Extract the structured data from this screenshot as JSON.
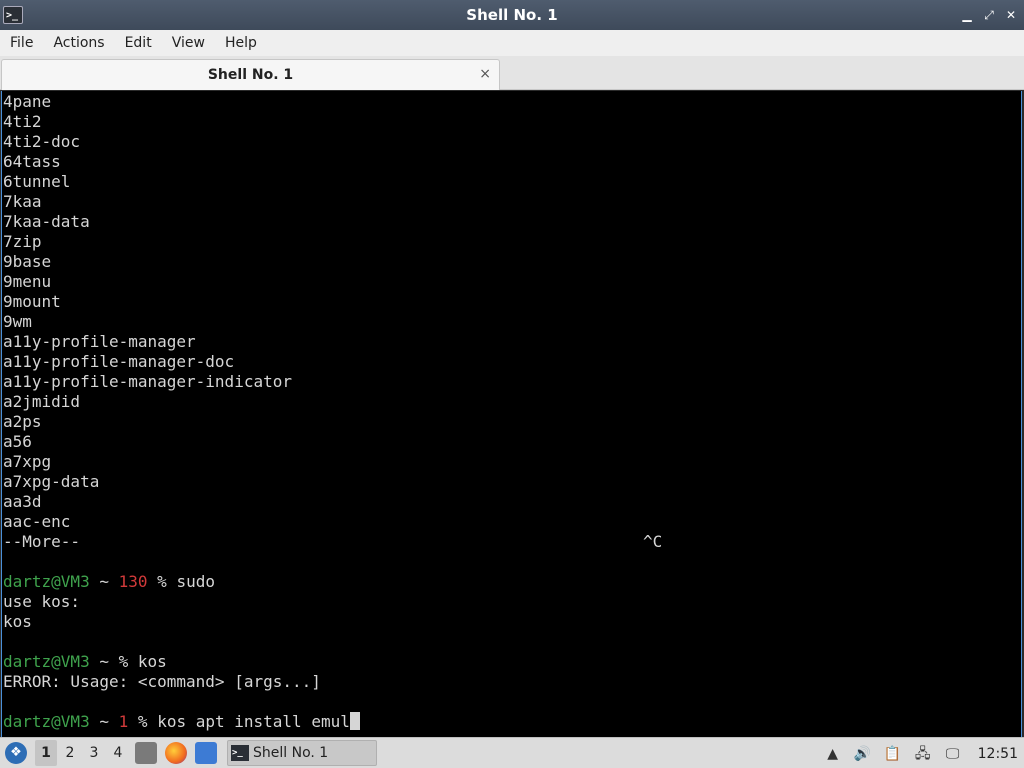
{
  "window": {
    "title": "Shell No. 1",
    "icon": "terminal-icon",
    "controls": [
      "minimize-icon",
      "maximize-icon",
      "close-icon"
    ]
  },
  "menu": {
    "items": [
      "File",
      "Actions",
      "Edit",
      "View",
      "Help"
    ]
  },
  "tab": {
    "label": "Shell No. 1",
    "close_glyph": "×"
  },
  "terminal": {
    "output_lines": [
      "4pane",
      "4ti2",
      "4ti2-doc",
      "64tass",
      "6tunnel",
      "7kaa",
      "7kaa-data",
      "7zip",
      "9base",
      "9menu",
      "9mount",
      "9wm",
      "a11y-profile-manager",
      "a11y-profile-manager-doc",
      "a11y-profile-manager-indicator",
      "a2jmidid",
      "a2ps",
      "a56",
      "a7xpg",
      "a7xpg-data",
      "aa3d",
      "aac-enc"
    ],
    "more_prompt": "--More--",
    "interrupt": "^C",
    "session1": {
      "user_host": "dartz@VM3",
      "path": "~",
      "status": "130",
      "symbol": "%",
      "command": "sudo",
      "out": [
        "use kos:",
        "kos"
      ]
    },
    "session2": {
      "user_host": "dartz@VM3",
      "path": "~",
      "symbol": "%",
      "command": "kos",
      "out": [
        "ERROR: Usage: <command> [args...]"
      ]
    },
    "session3": {
      "user_host": "dartz@VM3",
      "path": "~",
      "status": "1",
      "symbol": "%",
      "command": "kos apt install emul"
    }
  },
  "taskbar": {
    "workspaces": [
      "1",
      "2",
      "3",
      "4"
    ],
    "active_workspace": "1",
    "task_label": "Shell No. 1",
    "clock": "12:51"
  },
  "colors": {
    "prompt_user": "#3fa34d",
    "prompt_status": "#d23a3a",
    "terminal_bg": "#000000",
    "terminal_fg": "#d6d6d6"
  }
}
